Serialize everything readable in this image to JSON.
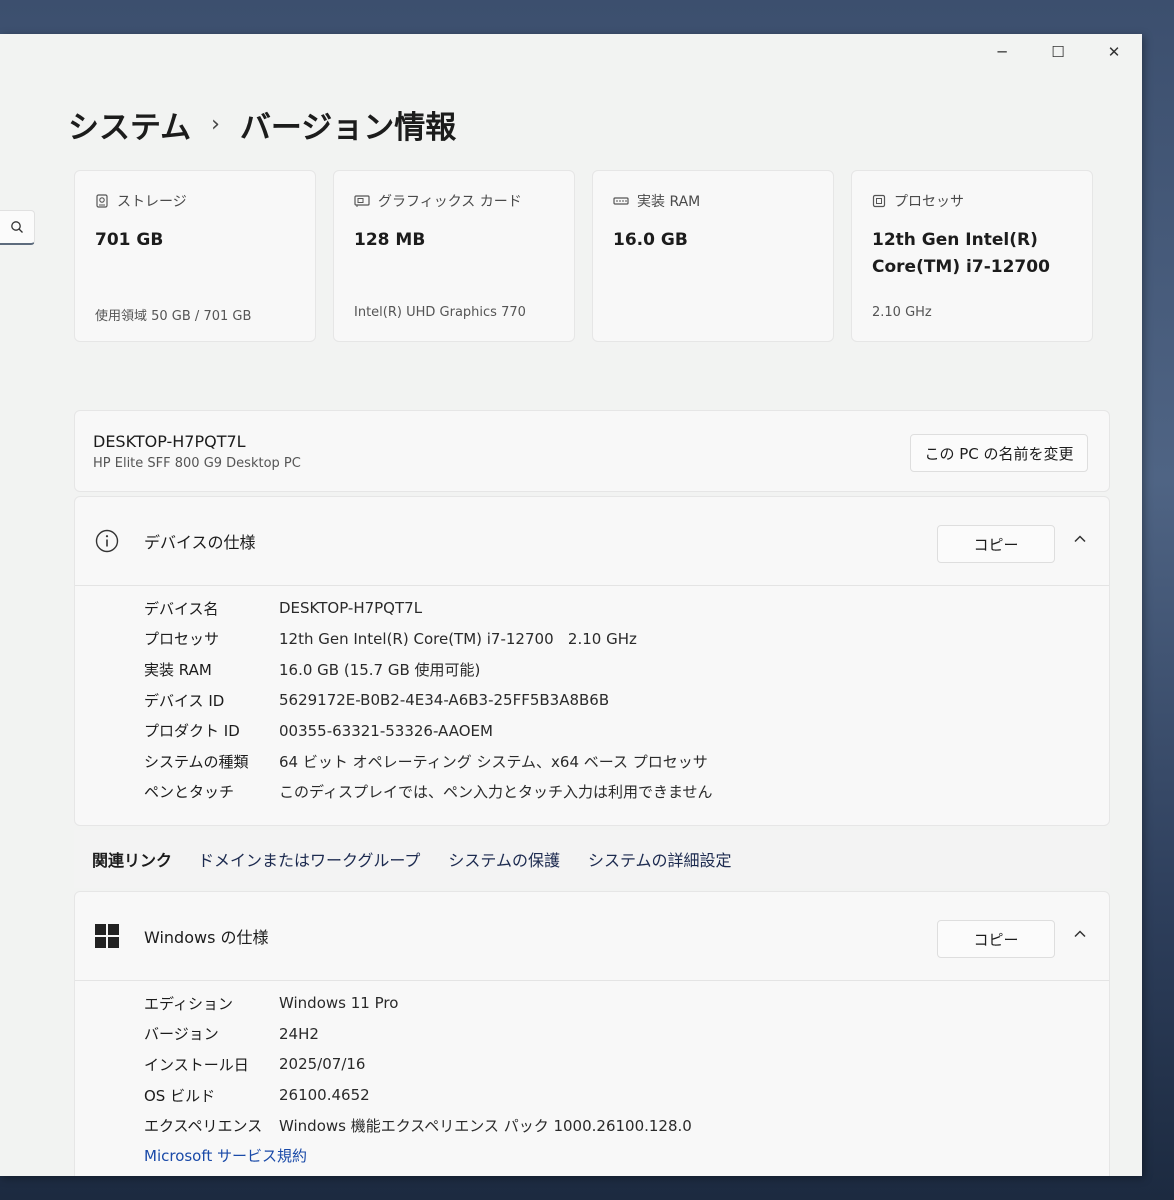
{
  "window_controls": {
    "minimize": "─",
    "maximize": "☐",
    "close": "✕"
  },
  "breadcrumb": {
    "parent": "システム",
    "separator": "›",
    "current": "バージョン情報"
  },
  "cards": [
    {
      "icon": "storage-icon",
      "label": "ストレージ",
      "value": "701 GB",
      "sub": "使用領域 50 GB / 701 GB"
    },
    {
      "icon": "graphics-card-icon",
      "label": "グラフィックス カード",
      "value": "128 MB",
      "sub": "Intel(R) UHD Graphics 770"
    },
    {
      "icon": "ram-icon",
      "label": "実装 RAM",
      "value": "16.0 GB",
      "sub": ""
    },
    {
      "icon": "processor-icon",
      "label": "プロセッサ",
      "value": "12th Gen Intel(R) Core(TM) i7-12700",
      "sub": "2.10 GHz"
    }
  ],
  "pc": {
    "name": "DESKTOP-H7PQT7L",
    "model": "HP Elite SFF 800 G9 Desktop PC",
    "rename_label": "この PC の名前を変更"
  },
  "device_spec": {
    "title": "デバイスの仕様",
    "copy_label": "コピー",
    "rows": [
      {
        "key": "デバイス名",
        "value": "DESKTOP-H7PQT7L"
      },
      {
        "key": "プロセッサ",
        "value": "12th Gen Intel(R) Core(TM) i7-12700   2.10 GHz"
      },
      {
        "key": "実装 RAM",
        "value": "16.0 GB (15.7 GB 使用可能)"
      },
      {
        "key": "デバイス ID",
        "value": "5629172E-B0B2-4E34-A6B3-25FF5B3A8B6B"
      },
      {
        "key": "プロダクト ID",
        "value": "00355-63321-53326-AAOEM"
      },
      {
        "key": "システムの種類",
        "value": "64 ビット オペレーティング システム、x64 ベース プロセッサ"
      },
      {
        "key": "ペンとタッチ",
        "value": "このディスプレイでは、ペン入力とタッチ入力は利用できません"
      }
    ]
  },
  "related_links": {
    "label": "関連リンク",
    "links": [
      "ドメインまたはワークグループ",
      "システムの保護",
      "システムの詳細設定"
    ]
  },
  "windows_spec": {
    "title": "Windows の仕様",
    "copy_label": "コピー",
    "rows": [
      {
        "key": "エディション",
        "value": "Windows 11 Pro"
      },
      {
        "key": "バージョン",
        "value": "24H2"
      },
      {
        "key": "インストール日",
        "value": "2025/07/16"
      },
      {
        "key": "OS ビルド",
        "value": "26100.4652"
      },
      {
        "key": "エクスペリエンス",
        "value": "Windows 機能エクスペリエンス パック 1000.26100.128.0"
      }
    ],
    "service_link": "Microsoft サービス規約"
  }
}
